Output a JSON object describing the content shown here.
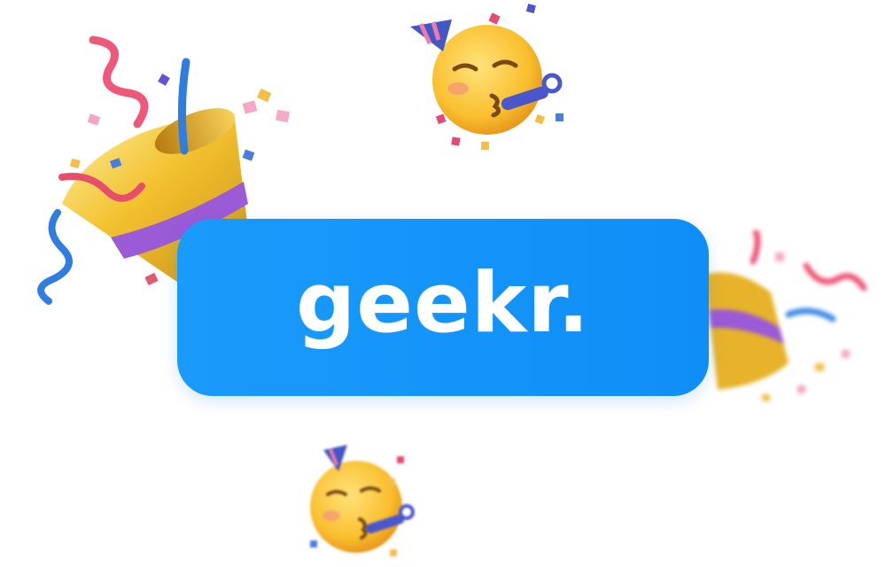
{
  "logo": {
    "text": "geekr."
  },
  "colors": {
    "badge": "#1493fa",
    "logo_text": "#ffffff",
    "background": "#ffffff"
  },
  "decorations": {
    "left": "party-popper-icon",
    "right": "party-popper-icon",
    "top": "partying-face-icon",
    "bottom": "partying-face-icon"
  }
}
